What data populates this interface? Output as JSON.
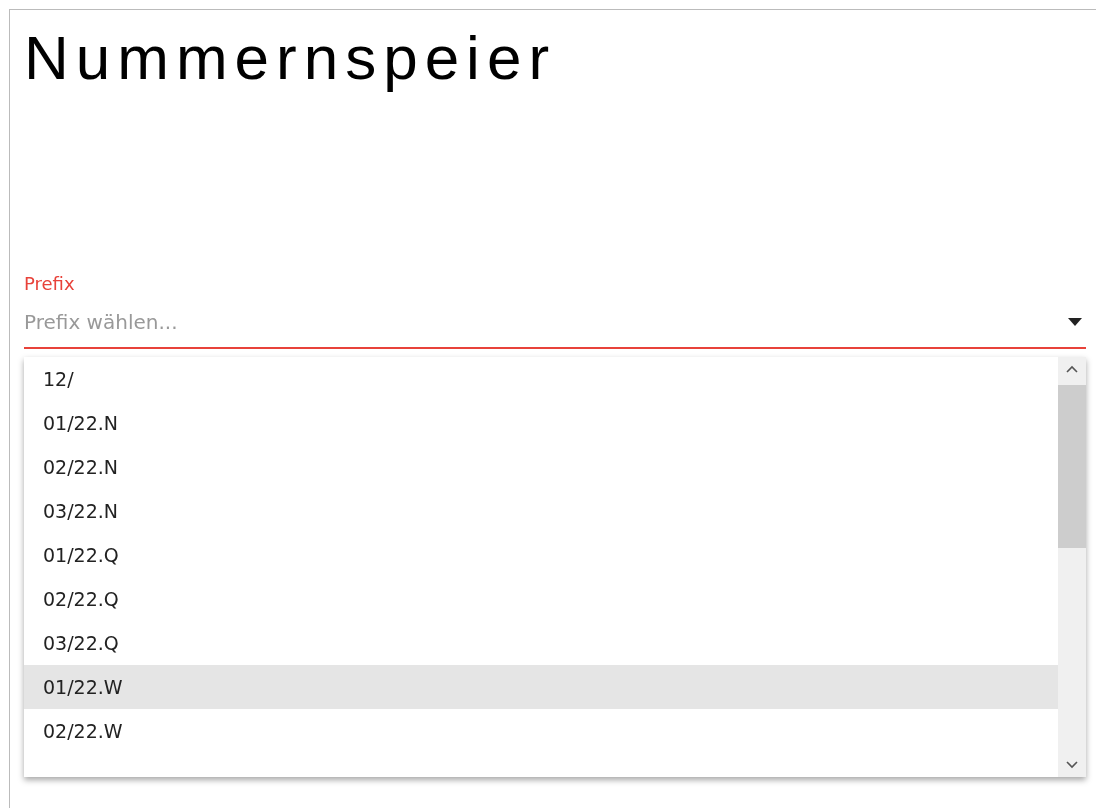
{
  "title": "Nummernspeier",
  "prefix_field": {
    "label": "Prefix",
    "placeholder": "Prefix wählen...",
    "expanded": true
  },
  "options": [
    {
      "label": "12/",
      "highlighted": false
    },
    {
      "label": "01/22.N",
      "highlighted": false
    },
    {
      "label": "02/22.N",
      "highlighted": false
    },
    {
      "label": "03/22.N",
      "highlighted": false
    },
    {
      "label": "01/22.Q",
      "highlighted": false
    },
    {
      "label": "02/22.Q",
      "highlighted": false
    },
    {
      "label": "03/22.Q",
      "highlighted": false
    },
    {
      "label": "01/22.W",
      "highlighted": true
    },
    {
      "label": "02/22.W",
      "highlighted": false
    }
  ]
}
